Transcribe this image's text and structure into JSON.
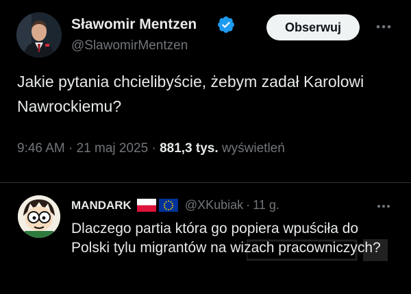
{
  "tweet": {
    "author_name": "Sławomir Mentzen",
    "author_handle": "@SlawomirMentzen",
    "follow_label": "Obserwuj",
    "text": "Jakie pytania chcielibyście, żebym zadał Karolowi Nawrockiemu?",
    "time": "9:46 AM",
    "date": "21 maj 2025",
    "views_count": "881,3 tys.",
    "views_label": "wyświetleń"
  },
  "reply": {
    "author_name": "MANDARK",
    "author_handle": "@XKubiak",
    "age": "11 g.",
    "text": "Dlaczego partia która go popiera wpuściła do Polski tylu migrantów na wizach pracowniczych?"
  },
  "icons": {
    "verified": "verified-badge-icon",
    "more": "more-dots-icon",
    "flag_pl": "poland-flag-icon",
    "flag_eu": "eu-flag-icon"
  },
  "colors": {
    "background": "#000000",
    "text_primary": "#e7e9ea",
    "text_secondary": "#71767b",
    "verified_blue": "#1d9bf0",
    "follow_bg": "#eff3f4"
  }
}
